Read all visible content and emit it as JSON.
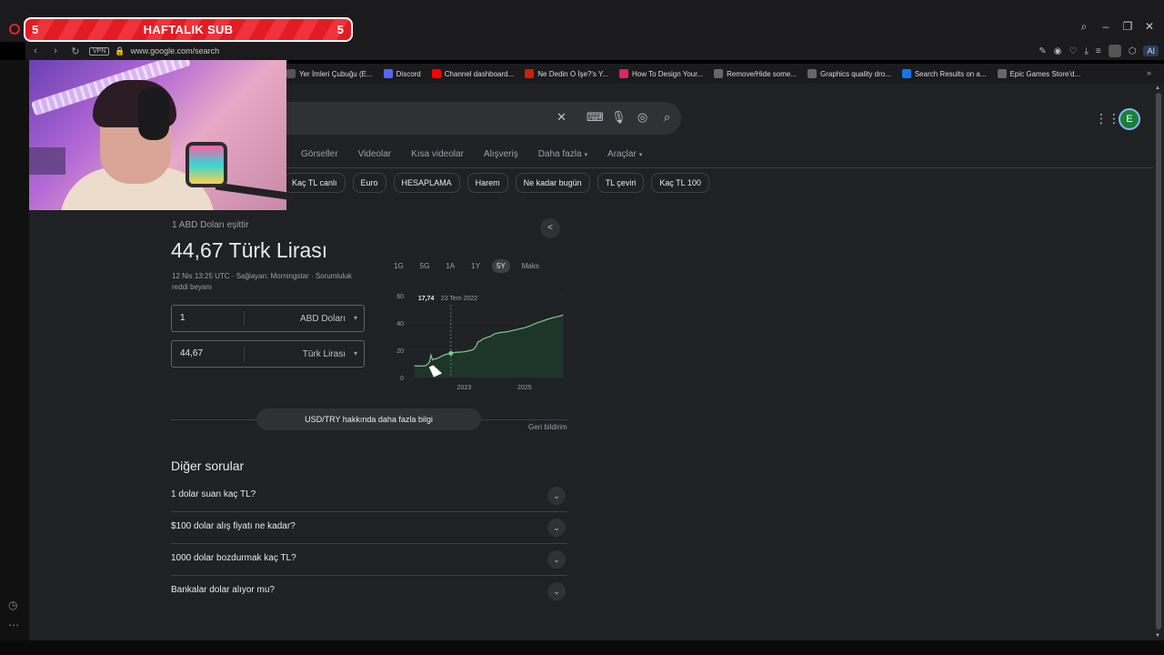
{
  "overlay": {
    "sub_title": "HAFTALIK SUB",
    "sub_left": "5",
    "sub_right": "5"
  },
  "browser": {
    "url": "www.google.com/search",
    "vpn_label": "VPN",
    "ai_label": "AI",
    "bookmarks": [
      {
        "label": "Yer İmleri Çubuğu (E...",
        "icon_color": "#555555"
      },
      {
        "label": "Discord",
        "icon_color": "#5865f2"
      },
      {
        "label": "Channel dashboard...",
        "icon_color": "#ff0000"
      },
      {
        "label": "Ne Dedin O İşe?'s Y...",
        "icon_color": "#cc2200"
      },
      {
        "label": "How To Design Your...",
        "icon_color": "#e0245e"
      },
      {
        "label": "Remove/Hide some...",
        "icon_color": "#666666"
      },
      {
        "label": "Graphics quality dro...",
        "icon_color": "#666666"
      },
      {
        "label": "Search Results on a...",
        "icon_color": "#1a73e8"
      },
      {
        "label": "Epic Games Store'd...",
        "icon_color": "#666666"
      }
    ]
  },
  "google": {
    "avatar_letter": "E",
    "tabs": [
      "Görseller",
      "Videolar",
      "Kısa videolar",
      "Alışveriş",
      "Daha fazla",
      "Araçlar"
    ],
    "chips": [
      "Kaç TL canlı",
      "Euro",
      "HESAPLAMA",
      "Harem",
      "Ne kadar bugün",
      "TL çeviri",
      "Kaç TL 100"
    ]
  },
  "currency": {
    "equals_label": "1 ABD Doları eşittir",
    "value": "44,67 Türk Lirası",
    "meta": "12 Nis 13:25 UTC · Sağlayan: Morningstar · Sorumluluk reddi beyanı",
    "from_amount": "1",
    "from_currency": "ABD Doları",
    "to_amount": "44,67",
    "to_currency": "Türk Lirası",
    "ranges": [
      "1G",
      "5G",
      "1A",
      "1Y",
      "5Y",
      "Maks"
    ],
    "active_range": "5Y",
    "more_info": "USD/TRY hakkında daha fazla bilgi",
    "feedback": "Geri bildirim"
  },
  "chart_data": {
    "type": "area",
    "x": [
      2021.35,
      2021.5,
      2021.65,
      2021.75,
      2021.85,
      2021.9,
      2021.95,
      2022.0,
      2022.1,
      2022.2,
      2022.3,
      2022.4,
      2022.56,
      2022.7,
      2022.8,
      2022.9,
      2023.0,
      2023.1,
      2023.3,
      2023.4,
      2023.45,
      2023.55,
      2023.6,
      2023.7,
      2023.9,
      2024.0,
      2024.2,
      2024.4,
      2024.6,
      2024.8,
      2025.0,
      2025.2,
      2025.4,
      2025.6,
      2025.8,
      2026.0,
      2026.2,
      2026.28
    ],
    "y": [
      8.6,
      8.4,
      8.5,
      9.0,
      11.5,
      16.5,
      13.0,
      13.5,
      14.0,
      15.0,
      16.2,
      17.0,
      17.74,
      18.5,
      18.6,
      18.7,
      18.9,
      19.3,
      20.5,
      23.0,
      26.0,
      27.0,
      28.0,
      29.0,
      30.5,
      32.0,
      33.0,
      33.5,
      34.5,
      35.5,
      36.5,
      38.0,
      40.0,
      41.5,
      43.0,
      44.2,
      45.2,
      46.0
    ],
    "ylim": [
      0,
      60
    ],
    "yticks": [
      0,
      20,
      40,
      60
    ],
    "xticks": [
      "2023",
      "2025"
    ],
    "xtick_values": [
      2023,
      2025
    ],
    "xlim": [
      2021.3,
      2026.3
    ],
    "tooltip": {
      "value": "17,74",
      "date": "23 Tem 2022",
      "x": 2022.56
    },
    "line_color": "#81c995",
    "fill_color": "#1e3b2a"
  },
  "paa": {
    "title": "Diğer sorular",
    "questions": [
      "1 dolar suan kaç TL?",
      "$100 dolar alış fiyatı ne kadar?",
      "1000 dolar bozdurmak kaç TL?",
      "Bankalar dolar alıyor mu?"
    ]
  }
}
